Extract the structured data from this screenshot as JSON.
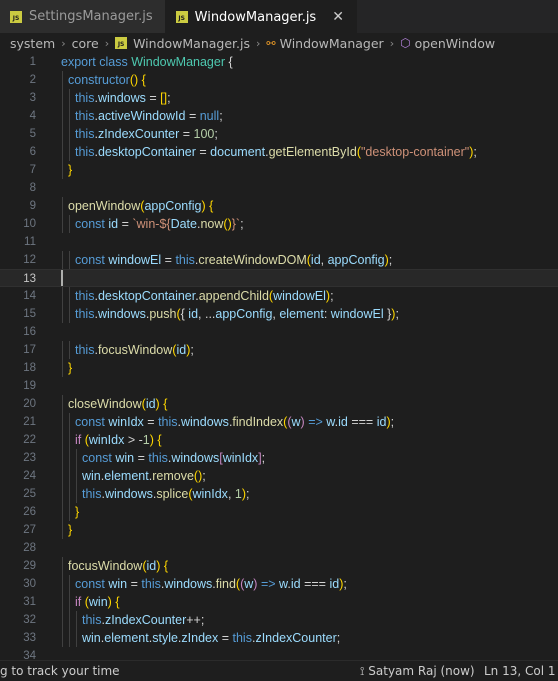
{
  "tabs": [
    {
      "icon": "js-file-icon",
      "label": "SettingsManager.js",
      "active": false
    },
    {
      "icon": "js-file-icon",
      "label": "WindowManager.js",
      "active": true,
      "close": "✕"
    }
  ],
  "breadcrumb": {
    "items": [
      "system",
      "core",
      "WindowManager.js",
      "WindowManager",
      "openWindow"
    ],
    "js_badge": "JS"
  },
  "editor": {
    "current_line": 13,
    "lines": [
      {
        "n": "1",
        "indent": 0,
        "tokens": [
          [
            "k",
            "export"
          ],
          [
            "p",
            " "
          ],
          [
            "k",
            "class"
          ],
          [
            "p",
            " "
          ],
          [
            "t",
            "WindowManager"
          ],
          [
            "p",
            " {"
          ]
        ]
      },
      {
        "n": "2",
        "indent": 1,
        "tokens": [
          [
            "k",
            "constructor"
          ],
          [
            "bk",
            "()"
          ],
          [
            "p",
            " "
          ],
          [
            "bk",
            "{"
          ]
        ]
      },
      {
        "n": "3",
        "indent": 2,
        "tokens": [
          [
            "k",
            "this"
          ],
          [
            "p",
            "."
          ],
          [
            "v",
            "windows"
          ],
          [
            "p",
            " = "
          ],
          [
            "bk",
            "[]"
          ],
          [
            "p",
            ";"
          ]
        ]
      },
      {
        "n": "4",
        "indent": 2,
        "tokens": [
          [
            "k",
            "this"
          ],
          [
            "p",
            "."
          ],
          [
            "v",
            "activeWindowId"
          ],
          [
            "p",
            " = "
          ],
          [
            "k",
            "null"
          ],
          [
            "p",
            ";"
          ]
        ]
      },
      {
        "n": "5",
        "indent": 2,
        "tokens": [
          [
            "k",
            "this"
          ],
          [
            "p",
            "."
          ],
          [
            "v",
            "zIndexCounter"
          ],
          [
            "p",
            " = "
          ],
          [
            "n",
            "100"
          ],
          [
            "p",
            ";"
          ]
        ]
      },
      {
        "n": "6",
        "indent": 2,
        "tokens": [
          [
            "k",
            "this"
          ],
          [
            "p",
            "."
          ],
          [
            "v",
            "desktopContainer"
          ],
          [
            "p",
            " = "
          ],
          [
            "v",
            "document"
          ],
          [
            "p",
            "."
          ],
          [
            "f",
            "getElementById"
          ],
          [
            "bk",
            "("
          ],
          [
            "s",
            "\"desktop-container\""
          ],
          [
            "bk",
            ")"
          ],
          [
            "p",
            ";"
          ]
        ]
      },
      {
        "n": "7",
        "indent": 1,
        "tokens": [
          [
            "bk",
            "}"
          ]
        ]
      },
      {
        "n": "8",
        "indent": 0,
        "tokens": []
      },
      {
        "n": "9",
        "indent": 1,
        "tokens": [
          [
            "f",
            "openWindow"
          ],
          [
            "bk",
            "("
          ],
          [
            "v",
            "appConfig"
          ],
          [
            "bk",
            ")"
          ],
          [
            "p",
            " "
          ],
          [
            "bk",
            "{"
          ]
        ]
      },
      {
        "n": "10",
        "indent": 2,
        "tokens": [
          [
            "k",
            "const"
          ],
          [
            "p",
            " "
          ],
          [
            "v",
            "id"
          ],
          [
            "p",
            " = "
          ],
          [
            "s",
            "`win-${"
          ],
          [
            "v",
            "Date"
          ],
          [
            "p",
            "."
          ],
          [
            "f",
            "now"
          ],
          [
            "bk",
            "()"
          ],
          [
            "s",
            "}`"
          ],
          [
            "p",
            ";"
          ]
        ]
      },
      {
        "n": "11",
        "indent": 0,
        "tokens": []
      },
      {
        "n": "12",
        "indent": 2,
        "tokens": [
          [
            "k",
            "const"
          ],
          [
            "p",
            " "
          ],
          [
            "v",
            "windowEl"
          ],
          [
            "p",
            " = "
          ],
          [
            "k",
            "this"
          ],
          [
            "p",
            "."
          ],
          [
            "f",
            "createWindowDOM"
          ],
          [
            "bk",
            "("
          ],
          [
            "v",
            "id"
          ],
          [
            "p",
            ", "
          ],
          [
            "v",
            "appConfig"
          ],
          [
            "bk",
            ")"
          ],
          [
            "p",
            ";"
          ]
        ]
      },
      {
        "n": "13",
        "indent": 0,
        "tokens": []
      },
      {
        "n": "14",
        "indent": 2,
        "tokens": [
          [
            "k",
            "this"
          ],
          [
            "p",
            "."
          ],
          [
            "v",
            "desktopContainer"
          ],
          [
            "p",
            "."
          ],
          [
            "f",
            "appendChild"
          ],
          [
            "bk",
            "("
          ],
          [
            "v",
            "windowEl"
          ],
          [
            "bk",
            ")"
          ],
          [
            "p",
            ";"
          ]
        ]
      },
      {
        "n": "15",
        "indent": 2,
        "tokens": [
          [
            "k",
            "this"
          ],
          [
            "p",
            "."
          ],
          [
            "v",
            "windows"
          ],
          [
            "p",
            "."
          ],
          [
            "f",
            "push"
          ],
          [
            "bk",
            "("
          ],
          [
            "p",
            "{ "
          ],
          [
            "v",
            "id"
          ],
          [
            "p",
            ", ..."
          ],
          [
            "v",
            "appConfig"
          ],
          [
            "p",
            ", "
          ],
          [
            "v",
            "element"
          ],
          [
            "p",
            ": "
          ],
          [
            "v",
            "windowEl"
          ],
          [
            "p",
            " }"
          ],
          [
            "bk",
            ")"
          ],
          [
            "p",
            ";"
          ]
        ]
      },
      {
        "n": "16",
        "indent": 0,
        "tokens": []
      },
      {
        "n": "17",
        "indent": 2,
        "tokens": [
          [
            "k",
            "this"
          ],
          [
            "p",
            "."
          ],
          [
            "f",
            "focusWindow"
          ],
          [
            "bk",
            "("
          ],
          [
            "v",
            "id"
          ],
          [
            "bk",
            ")"
          ],
          [
            "p",
            ";"
          ]
        ]
      },
      {
        "n": "18",
        "indent": 1,
        "tokens": [
          [
            "bk",
            "}"
          ]
        ]
      },
      {
        "n": "19",
        "indent": 0,
        "tokens": []
      },
      {
        "n": "20",
        "indent": 1,
        "tokens": [
          [
            "f",
            "closeWindow"
          ],
          [
            "bk",
            "("
          ],
          [
            "v",
            "id"
          ],
          [
            "bk",
            ")"
          ],
          [
            "p",
            " "
          ],
          [
            "bk",
            "{"
          ]
        ]
      },
      {
        "n": "21",
        "indent": 2,
        "tokens": [
          [
            "k",
            "const"
          ],
          [
            "p",
            " "
          ],
          [
            "v",
            "winIdx"
          ],
          [
            "p",
            " = "
          ],
          [
            "k",
            "this"
          ],
          [
            "p",
            "."
          ],
          [
            "v",
            "windows"
          ],
          [
            "p",
            "."
          ],
          [
            "f",
            "findIndex"
          ],
          [
            "bk",
            "("
          ],
          [
            "c",
            "("
          ],
          [
            "v",
            "w"
          ],
          [
            "c",
            ")"
          ],
          [
            "p",
            " "
          ],
          [
            "k",
            "=>"
          ],
          [
            "p",
            " "
          ],
          [
            "v",
            "w"
          ],
          [
            "p",
            "."
          ],
          [
            "v",
            "id"
          ],
          [
            "p",
            " === "
          ],
          [
            "v",
            "id"
          ],
          [
            "bk",
            ")"
          ],
          [
            "p",
            ";"
          ]
        ]
      },
      {
        "n": "22",
        "indent": 2,
        "tokens": [
          [
            "c",
            "if"
          ],
          [
            "p",
            " "
          ],
          [
            "bk",
            "("
          ],
          [
            "v",
            "winIdx"
          ],
          [
            "p",
            " > -"
          ],
          [
            "n",
            "1"
          ],
          [
            "bk",
            ")"
          ],
          [
            "p",
            " "
          ],
          [
            "bk",
            "{"
          ]
        ]
      },
      {
        "n": "23",
        "indent": 3,
        "tokens": [
          [
            "k",
            "const"
          ],
          [
            "p",
            " "
          ],
          [
            "v",
            "win"
          ],
          [
            "p",
            " = "
          ],
          [
            "k",
            "this"
          ],
          [
            "p",
            "."
          ],
          [
            "v",
            "windows"
          ],
          [
            "c",
            "["
          ],
          [
            "v",
            "winIdx"
          ],
          [
            "c",
            "]"
          ],
          [
            "p",
            ";"
          ]
        ]
      },
      {
        "n": "24",
        "indent": 3,
        "tokens": [
          [
            "v",
            "win"
          ],
          [
            "p",
            "."
          ],
          [
            "v",
            "element"
          ],
          [
            "p",
            "."
          ],
          [
            "f",
            "remove"
          ],
          [
            "bk",
            "()"
          ],
          [
            "p",
            ";"
          ]
        ]
      },
      {
        "n": "25",
        "indent": 3,
        "tokens": [
          [
            "k",
            "this"
          ],
          [
            "p",
            "."
          ],
          [
            "v",
            "windows"
          ],
          [
            "p",
            "."
          ],
          [
            "f",
            "splice"
          ],
          [
            "bk",
            "("
          ],
          [
            "v",
            "winIdx"
          ],
          [
            "p",
            ", "
          ],
          [
            "n",
            "1"
          ],
          [
            "bk",
            ")"
          ],
          [
            "p",
            ";"
          ]
        ]
      },
      {
        "n": "26",
        "indent": 2,
        "tokens": [
          [
            "bk",
            "}"
          ]
        ]
      },
      {
        "n": "27",
        "indent": 1,
        "tokens": [
          [
            "bk",
            "}"
          ]
        ]
      },
      {
        "n": "28",
        "indent": 0,
        "tokens": []
      },
      {
        "n": "29",
        "indent": 1,
        "tokens": [
          [
            "f",
            "focusWindow"
          ],
          [
            "bk",
            "("
          ],
          [
            "v",
            "id"
          ],
          [
            "bk",
            ")"
          ],
          [
            "p",
            " "
          ],
          [
            "bk",
            "{"
          ]
        ]
      },
      {
        "n": "30",
        "indent": 2,
        "tokens": [
          [
            "k",
            "const"
          ],
          [
            "p",
            " "
          ],
          [
            "v",
            "win"
          ],
          [
            "p",
            " = "
          ],
          [
            "k",
            "this"
          ],
          [
            "p",
            "."
          ],
          [
            "v",
            "windows"
          ],
          [
            "p",
            "."
          ],
          [
            "f",
            "find"
          ],
          [
            "bk",
            "("
          ],
          [
            "c",
            "("
          ],
          [
            "v",
            "w"
          ],
          [
            "c",
            ")"
          ],
          [
            "p",
            " "
          ],
          [
            "k",
            "=>"
          ],
          [
            "p",
            " "
          ],
          [
            "v",
            "w"
          ],
          [
            "p",
            "."
          ],
          [
            "v",
            "id"
          ],
          [
            "p",
            " === "
          ],
          [
            "v",
            "id"
          ],
          [
            "bk",
            ")"
          ],
          [
            "p",
            ";"
          ]
        ]
      },
      {
        "n": "31",
        "indent": 2,
        "tokens": [
          [
            "c",
            "if"
          ],
          [
            "p",
            " "
          ],
          [
            "bk",
            "("
          ],
          [
            "v",
            "win"
          ],
          [
            "bk",
            ")"
          ],
          [
            "p",
            " "
          ],
          [
            "bk",
            "{"
          ]
        ]
      },
      {
        "n": "32",
        "indent": 3,
        "tokens": [
          [
            "k",
            "this"
          ],
          [
            "p",
            "."
          ],
          [
            "v",
            "zIndexCounter"
          ],
          [
            "p",
            "++;"
          ]
        ]
      },
      {
        "n": "33",
        "indent": 3,
        "tokens": [
          [
            "v",
            "win"
          ],
          [
            "p",
            "."
          ],
          [
            "v",
            "element"
          ],
          [
            "p",
            "."
          ],
          [
            "v",
            "style"
          ],
          [
            "p",
            "."
          ],
          [
            "v",
            "zIndex"
          ],
          [
            "p",
            " = "
          ],
          [
            "k",
            "this"
          ],
          [
            "p",
            "."
          ],
          [
            "v",
            "zIndexCounter"
          ],
          [
            "p",
            ";"
          ]
        ]
      },
      {
        "n": "34",
        "indent": 0,
        "tokens": []
      }
    ]
  },
  "statusbar": {
    "left": "g to track your time",
    "blame": "Satyam Raj (now)",
    "position": "Ln 13, Col 1"
  }
}
